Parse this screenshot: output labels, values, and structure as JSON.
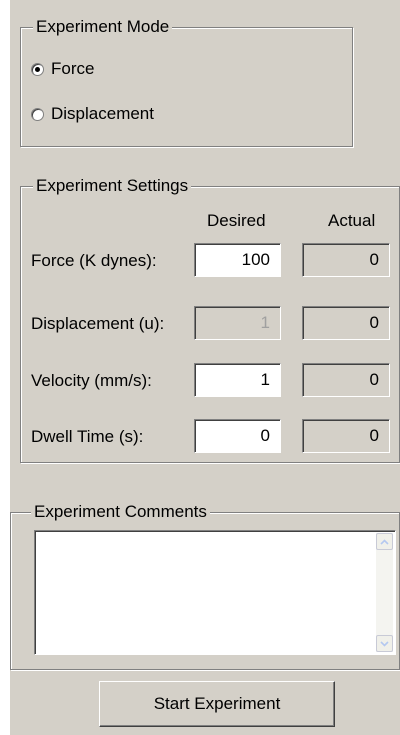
{
  "mode_group": {
    "title": "Experiment Mode",
    "options": [
      {
        "label": "Force",
        "selected": true
      },
      {
        "label": "Displacement",
        "selected": false
      }
    ]
  },
  "settings_group": {
    "title": "Experiment Settings",
    "col_desired": "Desired",
    "col_actual": "Actual",
    "rows": [
      {
        "label": "Force (K dynes):",
        "desired": "100",
        "actual": "0",
        "desired_enabled": true
      },
      {
        "label": "Displacement (u):",
        "desired": "1",
        "actual": "0",
        "desired_enabled": false
      },
      {
        "label": "Velocity (mm/s):",
        "desired": "1",
        "actual": "0",
        "desired_enabled": true
      },
      {
        "label": "Dwell Time (s):",
        "desired": "0",
        "actual": "0",
        "desired_enabled": true
      }
    ]
  },
  "comments_group": {
    "title": "Experiment Comments",
    "value": ""
  },
  "start_button": {
    "label": "Start Experiment"
  },
  "colors": {
    "panel_bg": "#d4d0c8",
    "window_bg": "#ffffff",
    "disabled_text": "#a0a0a0",
    "scroll_arrow": "#b4c8f0"
  }
}
